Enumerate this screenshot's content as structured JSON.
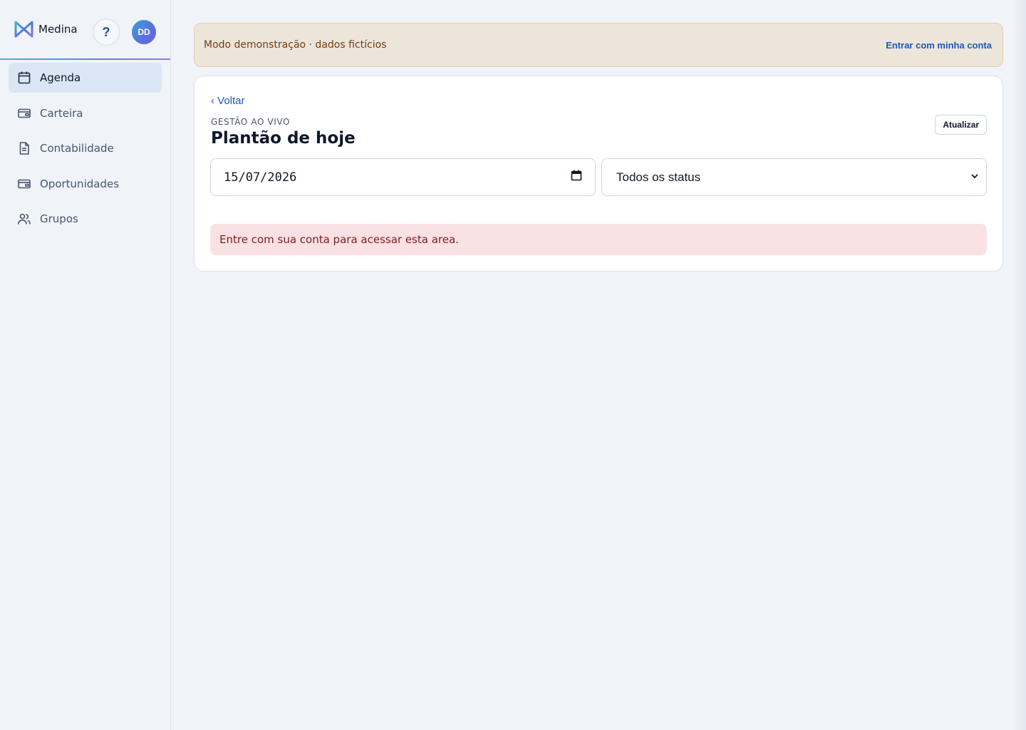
{
  "app": {
    "name": "Medina",
    "help_label": "?",
    "avatar_initials": "DD",
    "brand_colors": {
      "accent": "#1f57c0",
      "gradient_start": "#3fb8c9",
      "gradient_end": "#8f7be0"
    }
  },
  "sidebar": {
    "items": [
      {
        "label": "Agenda",
        "icon": "calendar-icon",
        "active": true
      },
      {
        "label": "Carteira",
        "icon": "wallet-icon",
        "active": false
      },
      {
        "label": "Contabilidade",
        "icon": "document-icon",
        "active": false
      },
      {
        "label": "Oportunidades",
        "icon": "wallet-icon",
        "active": false
      },
      {
        "label": "Grupos",
        "icon": "users-icon",
        "active": false
      }
    ]
  },
  "banner": {
    "text": "Modo demonstração · dados fictícios",
    "link_label": "Entrar com minha conta"
  },
  "page": {
    "back_label": "‹ Voltar",
    "kicker": "GESTÃO AO VIVO",
    "title": "Plantão de hoje",
    "refresh_label": "Atualizar",
    "date_value": "15/07/2026",
    "status_selected": "Todos os status",
    "alert_text": "Entre com sua conta para acessar esta area."
  }
}
